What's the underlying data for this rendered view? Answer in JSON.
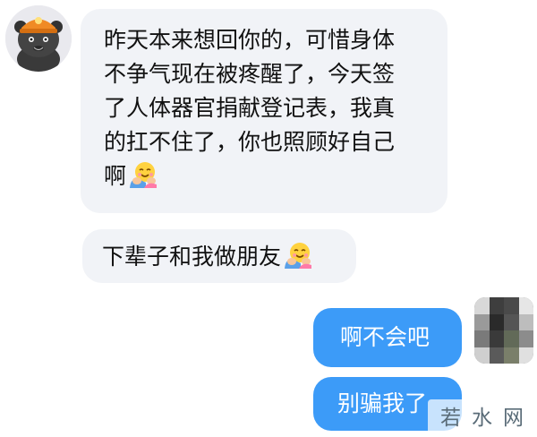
{
  "conversation": {
    "incoming": {
      "message1": {
        "lines": [
          "昨天本来想回你的，可惜身体",
          "不争气现在被疼醒了，今天签",
          "了人体器官捐献登记表，我真",
          "的扛不住了，你也照顾好自己",
          "啊"
        ],
        "emoji": "hug-emoji"
      },
      "message2": {
        "text": "下辈子和我做朋友",
        "emoji": "hug-emoji"
      }
    },
    "outgoing": {
      "message1": {
        "text": "啊不会吧"
      },
      "message2": {
        "text": "别骗我了"
      }
    }
  },
  "avatars": {
    "left": "cartoon-character-avatar",
    "right": "pixelated-avatar"
  },
  "watermark": {
    "text": "若水网"
  },
  "colors": {
    "incoming_bubble": "#f1f3f7",
    "outgoing_bubble": "#3c9bf8",
    "text_dark": "#111111",
    "text_light": "#ffffff"
  }
}
